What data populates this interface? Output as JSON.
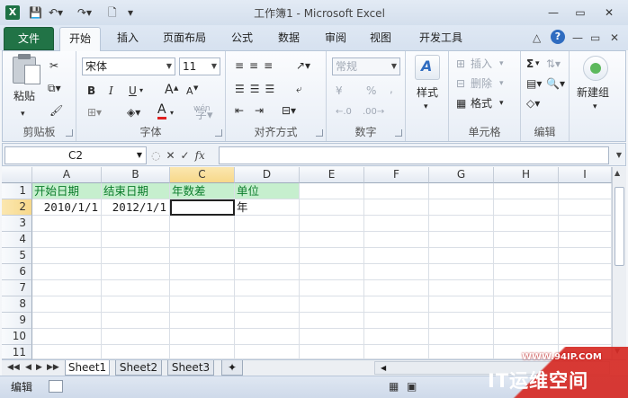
{
  "window": {
    "title": "工作簿1 - Microsoft Excel",
    "app_icon": "X"
  },
  "qat": {
    "save_icon": "save-icon",
    "undo_icon": "undo-icon",
    "redo_icon": "redo-icon",
    "print_preview_icon": "print-preview-icon",
    "customize_icon": "customize-qat-icon"
  },
  "ribbon_tabs": {
    "file": "文件",
    "items": [
      "开始",
      "插入",
      "页面布局",
      "公式",
      "数据",
      "审阅",
      "视图",
      "开发工具"
    ],
    "active": "开始"
  },
  "home": {
    "clipboard": {
      "label": "剪贴板",
      "paste": "粘贴"
    },
    "font": {
      "label": "字体",
      "font_name": "宋体",
      "font_size": "11",
      "bold": "B",
      "italic": "I",
      "underline": "U",
      "grow": "A",
      "shrink": "A",
      "font_color_glyph": "A",
      "phonetic": "wén"
    },
    "alignment": {
      "label": "对齐方式"
    },
    "number": {
      "label": "数字",
      "format": "常规",
      "currency": "¥",
      "percent": "%",
      "comma": ","
    },
    "styles": {
      "label": "样式"
    },
    "cells": {
      "label": "单元格",
      "insert": "插入",
      "delete": "删除",
      "format": "格式"
    },
    "editing": {
      "label": "编辑",
      "sum": "Σ"
    },
    "new_group": {
      "label": "新建组"
    }
  },
  "formula_bar": {
    "name_box": "C2",
    "fx": "fx",
    "formula": ""
  },
  "grid": {
    "columns": [
      "A",
      "B",
      "C",
      "D",
      "E",
      "F",
      "G",
      "H",
      "I"
    ],
    "rows": [
      "1",
      "2",
      "3",
      "4",
      "5",
      "6",
      "7",
      "8",
      "9",
      "10",
      "11"
    ],
    "cells": {
      "A1": "开始日期",
      "B1": "结束日期",
      "C1": "年数差",
      "D1": "单位",
      "A2": "2010/1/1",
      "B2": "2012/1/1",
      "C2": "",
      "D2": "年"
    },
    "selected_cell": "C2"
  },
  "sheets": [
    "Sheet1",
    "Sheet2",
    "Sheet3"
  ],
  "active_sheet": "Sheet1",
  "status": {
    "mode": "编辑"
  },
  "watermark": {
    "url": "WWW.94IP.COM",
    "text": "IT运维空间"
  },
  "colors": {
    "file_tab": "#217346",
    "highlight_fill": "#c6efce",
    "highlight_text": "#0b7d2b",
    "watermark": "#d62a24"
  }
}
